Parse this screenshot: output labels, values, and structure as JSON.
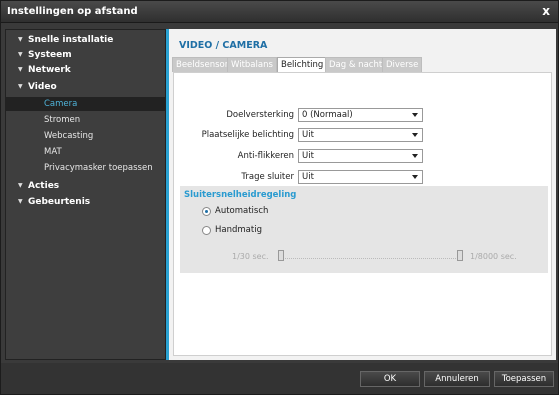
{
  "window": {
    "title": "Instellingen op afstand",
    "close_glyph": "x"
  },
  "sidebar": {
    "items": [
      {
        "label": "Snelle installatie",
        "level": 0
      },
      {
        "label": "Systeem",
        "level": 0
      },
      {
        "label": "Netwerk",
        "level": 0
      },
      {
        "label": "Video",
        "level": 0
      },
      {
        "label": "Camera",
        "level": 1,
        "active": true
      },
      {
        "label": "Stromen",
        "level": 1
      },
      {
        "label": "Webcasting",
        "level": 1
      },
      {
        "label": "MAT",
        "level": 1
      },
      {
        "label": "Privacymasker toepassen",
        "level": 1
      },
      {
        "label": "Acties",
        "level": 0
      },
      {
        "label": "Gebeurtenis",
        "level": 0
      }
    ]
  },
  "main": {
    "section_title": "VIDEO / CAMERA",
    "tabs": [
      "Beeldsensor",
      "Witbalans",
      "Belichting",
      "Dag & nacht",
      "Diverse"
    ],
    "active_tab": "Belichting",
    "fields": [
      {
        "label": "Doelversterking",
        "value": "0 (Normaal)"
      },
      {
        "label": "Plaatselijke belichting",
        "value": "Uit"
      },
      {
        "label": "Anti-flikkeren",
        "value": "Uit"
      },
      {
        "label": "Trage sluiter",
        "value": "Uit"
      }
    ],
    "shutter": {
      "title": "Sluitersnelheidregeling",
      "options": [
        "Automatisch",
        "Handmatig"
      ],
      "selected": "Automatisch",
      "min_label": "1/30 sec.",
      "max_label": "1/8000 sec."
    }
  },
  "footer": {
    "ok": "OK",
    "cancel": "Annuleren",
    "apply": "Toepassen"
  },
  "colors": {
    "accent": "#2aa2d2",
    "title_blue": "#1f6fa5",
    "active_nav": "#4fb3d9"
  }
}
